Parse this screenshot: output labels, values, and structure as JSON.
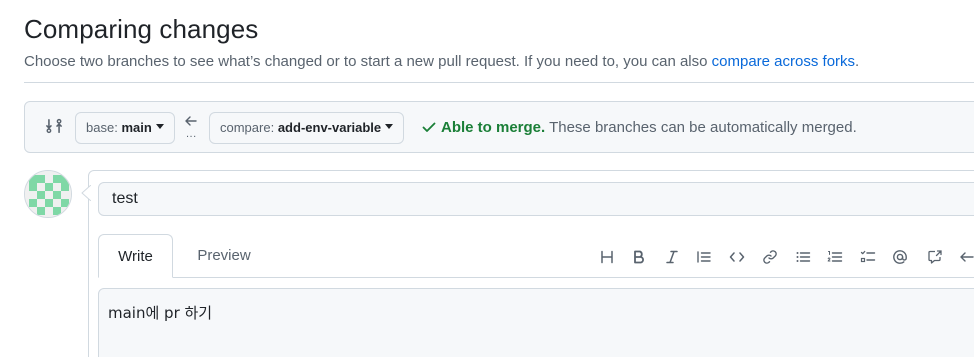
{
  "header": {
    "title": "Comparing changes",
    "subtitle": "Choose two branches to see what’s changed or to start a new pull request. If you need to, you can also ",
    "subtitle_link": "compare across forks",
    "subtitle_end": "."
  },
  "range": {
    "base_label": "base:",
    "base_branch": "main",
    "compare_label": "compare:",
    "compare_branch": "add-env-variable",
    "dots": "...",
    "merge_status": "Able to merge.",
    "merge_detail": " These branches can be automatically merged."
  },
  "form": {
    "title_value": "test",
    "tabs": [
      {
        "label": "Write"
      },
      {
        "label": "Preview"
      }
    ],
    "body_value": "main에 pr 하기"
  },
  "toolbar": {
    "icons": [
      "heading-icon",
      "bold-icon",
      "italic-icon",
      "quote-icon",
      "code-icon",
      "link-icon",
      "unordered-list-icon",
      "ordered-list-icon",
      "task-list-icon",
      "mention-icon",
      "cross-reference-icon",
      "undo-icon"
    ]
  },
  "colors": {
    "accent_link": "#0969da",
    "merge_ok": "#1a7f37",
    "border": "#d1d9e0",
    "muted_text": "#59636e"
  }
}
